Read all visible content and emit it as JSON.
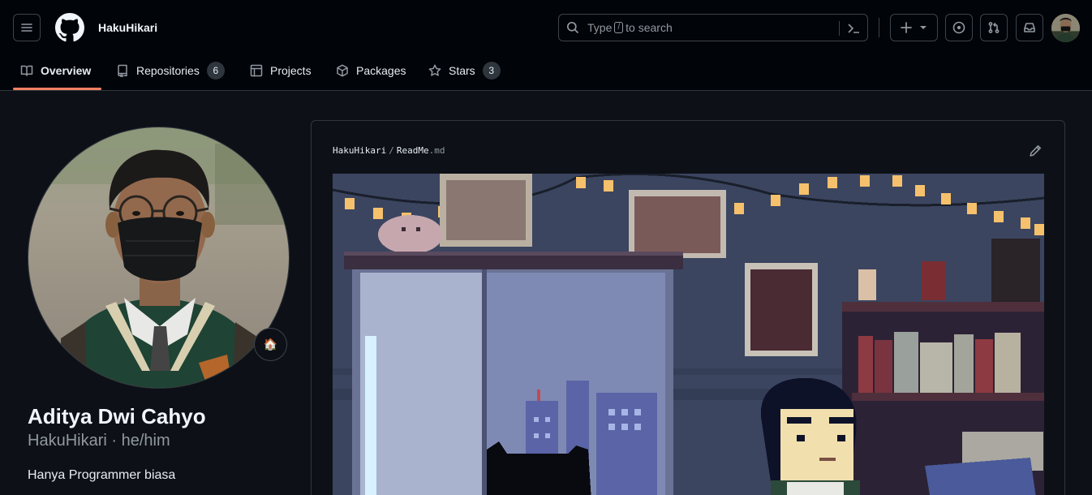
{
  "header": {
    "username": "HakuHikari",
    "search": {
      "prefix": "Type",
      "key": "/",
      "suffix": "to search"
    },
    "icons": [
      "hamburger-icon",
      "github-logo-icon",
      "search-icon",
      "command-palette-icon",
      "plus-icon",
      "chevron-down-icon",
      "issues-icon",
      "pull-request-icon",
      "inbox-icon"
    ]
  },
  "tabs": [
    {
      "label": "Overview",
      "icon": "book-icon"
    },
    {
      "label": "Repositories",
      "icon": "repo-icon",
      "count": "6"
    },
    {
      "label": "Projects",
      "icon": "table-icon"
    },
    {
      "label": "Packages",
      "icon": "package-icon"
    },
    {
      "label": "Stars",
      "icon": "star-icon",
      "count": "3"
    }
  ],
  "profile": {
    "full_name": "Aditya Dwi Cahyo",
    "login_line": "HakuHikari · he/him",
    "bio": "Hanya Programmer biasa",
    "status_emoji": "🏠"
  },
  "readme": {
    "owner": "HakuHikari",
    "separator": "/",
    "file_name": "ReadMe",
    "file_ext": ".md"
  },
  "colors": {
    "header_bg": "#010409",
    "page_bg": "#0d1117",
    "accent_underline": "#f78166",
    "border": "#30363d"
  }
}
